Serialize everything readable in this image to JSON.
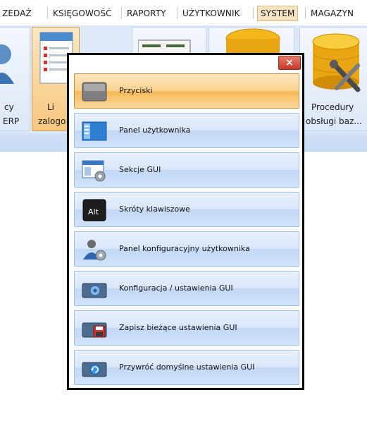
{
  "menubar": {
    "items": [
      "ZEDAŻ",
      "KSIĘGOWOŚĆ",
      "RAPORTY",
      "UŻYTKOWNIK",
      "SYSTEM",
      "MAGAZYN"
    ],
    "active": "SYSTEM"
  },
  "ribbon": {
    "left_labels": [
      "cy",
      "ERP"
    ],
    "selected_labels": [
      "Li",
      "zalogo"
    ],
    "procedure_labels": [
      "Procedury",
      "obsługi baz..."
    ]
  },
  "popup": {
    "close_label": "×",
    "items": [
      {
        "label": "Przyciski",
        "icon": "button-icon"
      },
      {
        "label": "Panel użytkownika",
        "icon": "user-panel-icon"
      },
      {
        "label": "Sekcje GUI",
        "icon": "gui-window-gear-icon"
      },
      {
        "label": "Skróty klawiszowe",
        "icon": "alt-key-icon"
      },
      {
        "label": "Panel konfiguracyjny użytkownika",
        "icon": "user-gear-icon"
      },
      {
        "label": "Konfiguracja / ustawienia GUI",
        "icon": "gear-settings-icon"
      },
      {
        "label": "Zapisz bieżące ustawienia GUI",
        "icon": "save-icon"
      },
      {
        "label": "Przywróć domyślne ustawienia GUI",
        "icon": "restore-icon"
      }
    ],
    "active_index": 0
  },
  "colors": {
    "active_item": "#f7b857",
    "item": "#c1d8f6",
    "close_button": "#c8382b",
    "ribbon": "#dde9f8"
  }
}
